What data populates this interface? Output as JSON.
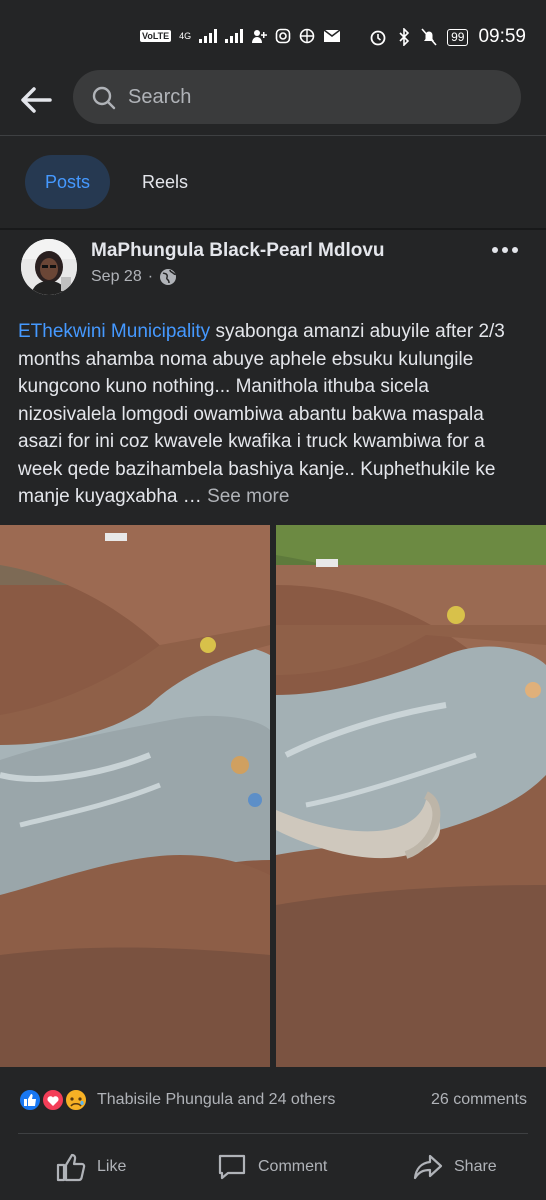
{
  "status_bar": {
    "network_label": "VoLTE",
    "data_label": "4G",
    "battery": "99",
    "time": "09:59"
  },
  "search": {
    "placeholder": "Search"
  },
  "tabs": [
    {
      "label": "Posts",
      "active": true
    },
    {
      "label": "Reels",
      "active": false
    }
  ],
  "post": {
    "author": "MaPhungula Black-Pearl Mdlovu",
    "date": "Sep 28",
    "separator": "·",
    "privacy_icon": "globe-icon",
    "mention": "EThekwini Municipality",
    "body": " syabonga amanzi abuyile after 2/3 months ahamba noma abuye aphele ebsuku kulungile kungcono kuno nothing... Manithola ithuba sicela nizosivalela lomgodi owambiwa abantu bakwa maspala asazi for ini coz kwavele kwafika i truck kwambiwa for a week qede bazihambela bashiya kanje.. Kuphethukile ke manje kuyagxabha … ",
    "see_more": "See more",
    "photo_count": 2
  },
  "reactions": {
    "icons": [
      "like-reaction-icon",
      "love-reaction-icon",
      "sad-reaction-icon"
    ],
    "summary": "Thabisile Phungula and 24 others",
    "comments": "26 comments"
  },
  "actions": {
    "like": "Like",
    "comment": "Comment",
    "share": "Share"
  },
  "colors": {
    "background": "#242526",
    "accent": "#4599ff",
    "secondary_text": "#b0b3b8",
    "search_bg": "#3a3b3c"
  }
}
